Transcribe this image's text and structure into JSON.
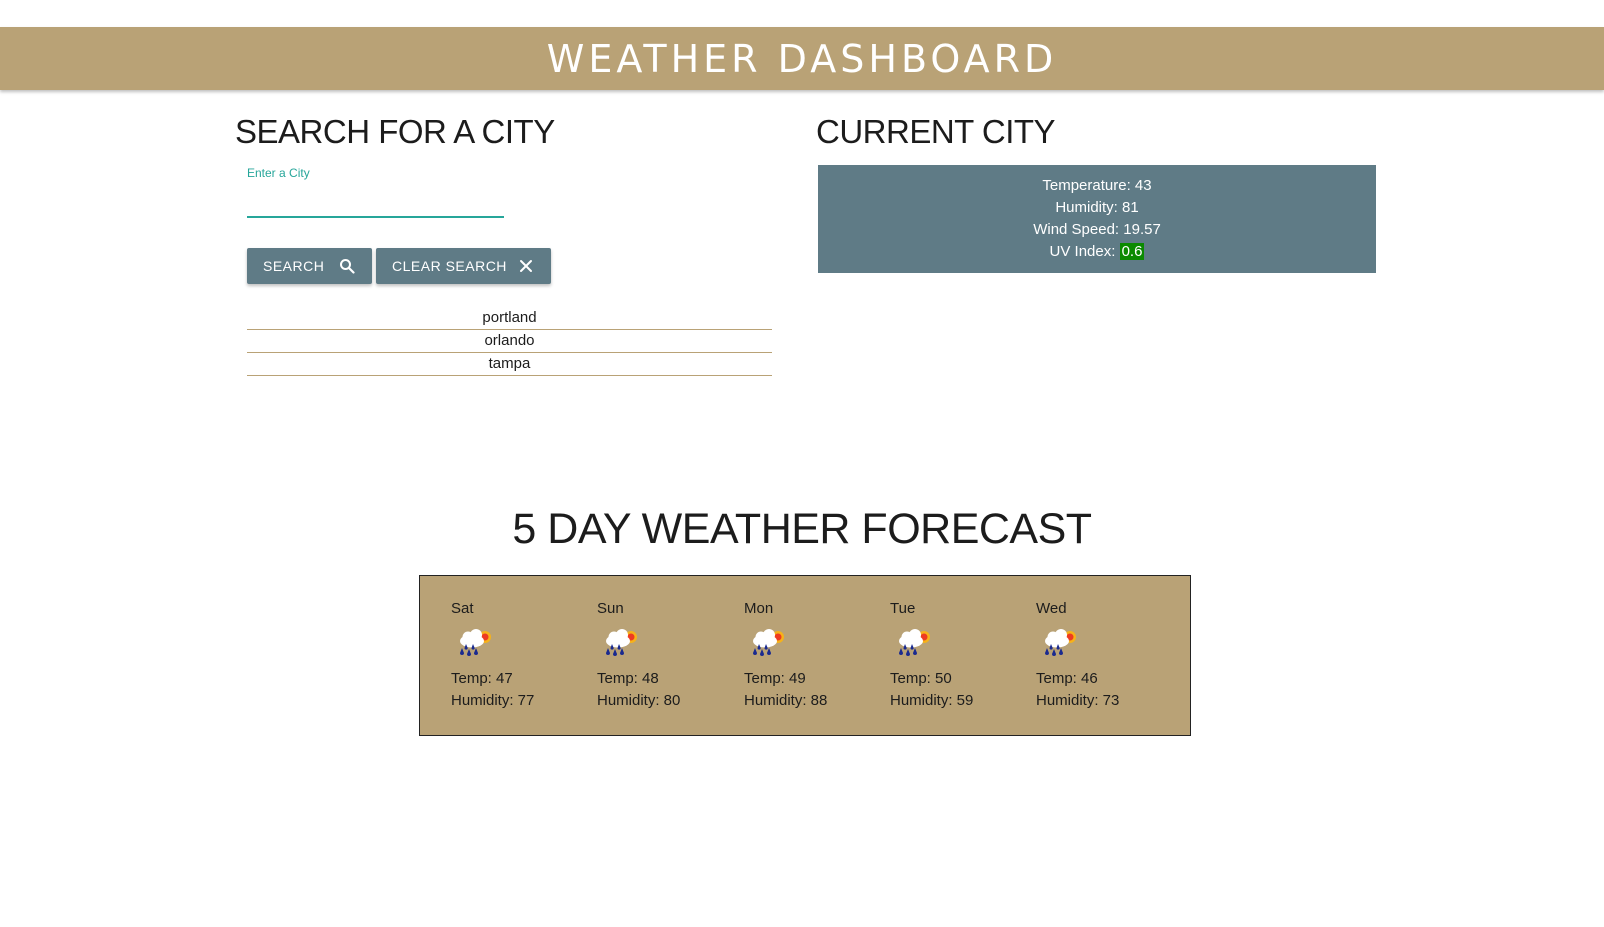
{
  "header": {
    "title": "WEATHER DASHBOARD"
  },
  "search": {
    "heading": "SEARCH FOR A CITY",
    "input_label": "Enter a City",
    "input_value": "",
    "search_label": "SEARCH",
    "clear_label": "CLEAR SEARCH",
    "history": [
      "portland",
      "orlando",
      "tampa"
    ]
  },
  "current": {
    "heading": "CURRENT CITY",
    "temperature": "Temperature: 43",
    "humidity": "Humidity: 81",
    "wind": "Wind Speed: 19.57",
    "uv_label": "UV Index:",
    "uv_value": "0.6",
    "uv_color": "#0b8a00"
  },
  "forecast": {
    "heading": "5 DAY WEATHER FORECAST",
    "days": [
      {
        "day": "Sat",
        "icon": "rain-cloud-sun-icon",
        "temp": "Temp: 47",
        "humidity": "Humidity: 77"
      },
      {
        "day": "Sun",
        "icon": "rain-cloud-sun-icon",
        "temp": "Temp: 48",
        "humidity": "Humidity: 80"
      },
      {
        "day": "Mon",
        "icon": "rain-cloud-sun-icon",
        "temp": "Temp: 49",
        "humidity": "Humidity: 88"
      },
      {
        "day": "Tue",
        "icon": "rain-cloud-sun-icon",
        "temp": "Temp: 50",
        "humidity": "Humidity: 59"
      },
      {
        "day": "Wed",
        "icon": "rain-cloud-sun-icon",
        "temp": "Temp: 46",
        "humidity": "Humidity: 73"
      }
    ]
  },
  "colors": {
    "accent": "#b9a276",
    "panel": "#5f7b86",
    "input_underline": "#26a69a"
  }
}
